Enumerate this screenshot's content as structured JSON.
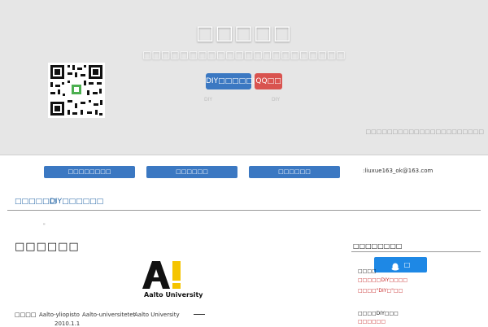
{
  "header": {
    "site_title": "□□□□□",
    "subtitle": "□□□□□□□□□□□□□□□□□□□□□□",
    "diy_button": "DIY□□□□□□",
    "qq_button": "QQ□□",
    "tiny_left": "DIY",
    "tiny_right": "DIY",
    "notice": "□□□□□□□□□□□□□□□□□□□□□□"
  },
  "nav": {
    "items": [
      "□□□□□□□□",
      "□□□□□□",
      "□□□□□□"
    ],
    "email": ":liuxue163_ok@163.com"
  },
  "breadcrumb": {
    "home": "□□□□□□",
    "current": "DIY□□□□□□"
  },
  "article": {
    "dot": "\"",
    "heading": "□□□□□□",
    "logo_text": "Aalto University",
    "row_label": "□□□□",
    "names": [
      "Aalto-yliopisto",
      "Aalto-universitetet",
      "Aalto University"
    ],
    "date": "2010.1.1"
  },
  "sidebar": {
    "title": "□□□□□□□□",
    "qq_button": "□",
    "line1": "□□□□",
    "line2": "□□□□□DIY□□□□",
    "line3": "□□□□\"DIY□\"□□",
    "line4": "□□□□DIY□□□",
    "line5": "□□□□□□"
  },
  "colors": {
    "primary_button": "#3b78c2",
    "qq_red": "#d9534f",
    "qq_blue": "#1e88e5",
    "link": "#2b6aa8"
  }
}
